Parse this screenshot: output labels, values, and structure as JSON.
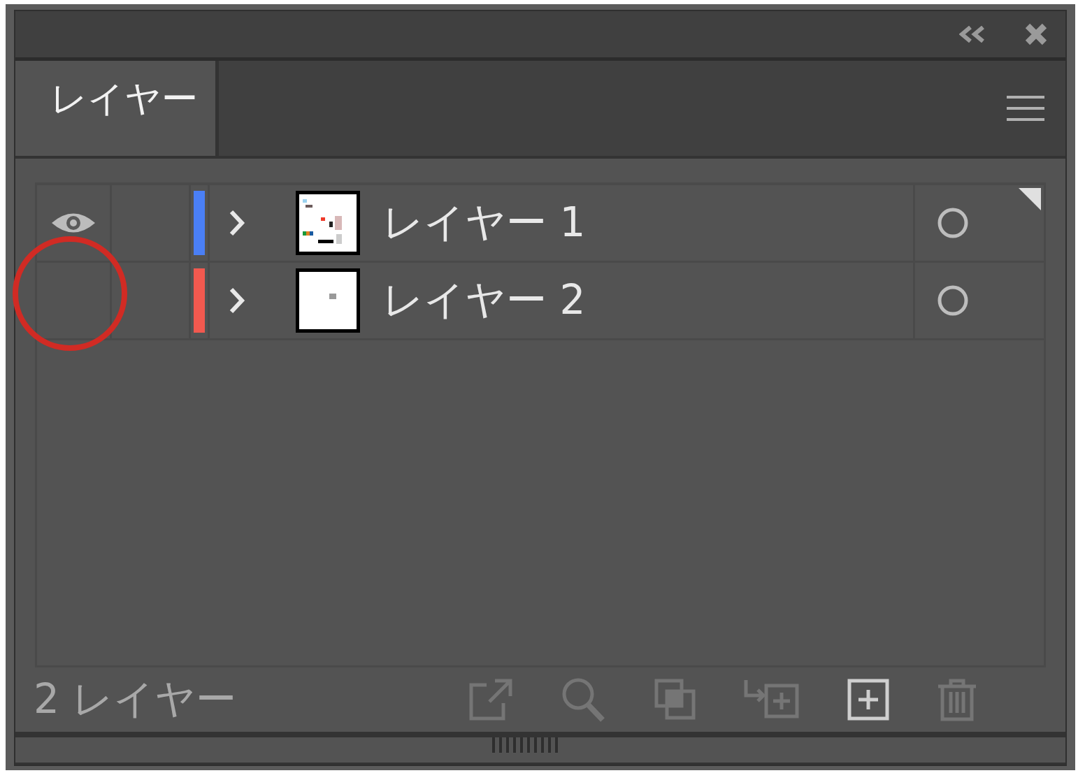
{
  "tabs": [
    {
      "label": "レイヤー",
      "selected": true
    }
  ],
  "layers": [
    {
      "name": "レイヤー 1",
      "visible": true,
      "color": "#4a7ff5",
      "expanded": false,
      "current": true
    },
    {
      "name": "レイヤー 2",
      "visible": false,
      "color": "#f2594f",
      "expanded": false,
      "current": false
    }
  ],
  "status": "2 レイヤー",
  "toolbar": [
    {
      "kind": "export",
      "disabled": true
    },
    {
      "kind": "search",
      "disabled": true
    },
    {
      "kind": "clip",
      "disabled": true
    },
    {
      "kind": "sublayer",
      "disabled": true
    },
    {
      "kind": "new-layer",
      "disabled": false
    },
    {
      "kind": "delete",
      "disabled": true
    }
  ],
  "annotations": [
    {
      "kind": "circle",
      "color": "#d12b24"
    }
  ]
}
